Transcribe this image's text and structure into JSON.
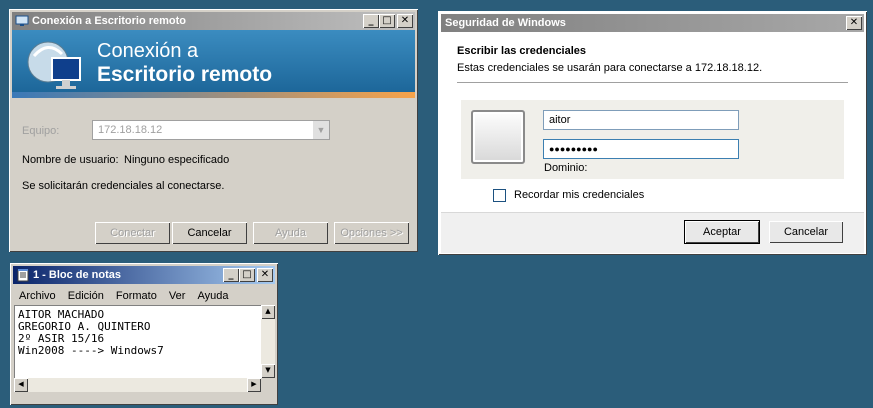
{
  "rdp": {
    "title": "Conexión a Escritorio remoto",
    "banner_line1": "Conexión a",
    "banner_line2": "Escritorio remoto",
    "equipo_label": "Equipo:",
    "equipo_value": "172.18.18.12",
    "usuario_label": "Nombre de usuario:",
    "usuario_value": "Ninguno especificado",
    "info_text": "Se solicitarán credenciales al conectarse.",
    "buttons": {
      "connect": "Conectar",
      "cancel": "Cancelar",
      "help": "Ayuda",
      "options": "Opciones >>"
    }
  },
  "security": {
    "title": "Seguridad de Windows",
    "heading": "Escribir las credenciales",
    "subheading": "Estas credenciales se usarán para conectarse a 172.18.18.12.",
    "username_value": "aitor",
    "password_mask": "●●●●●●●●●",
    "domain_label": "Dominio:",
    "remember_label": "Recordar mis credenciales",
    "accept_label": "Aceptar",
    "cancel_label": "Cancelar"
  },
  "notepad": {
    "title": "1 - Bloc de notas",
    "menu": [
      "Archivo",
      "Edición",
      "Formato",
      "Ver",
      "Ayuda"
    ],
    "lines": [
      "AITOR MACHADO",
      "GREGORIO A. QUINTERO",
      "2º ASIR 15/16",
      "Win2008 ----> Windows7"
    ]
  },
  "colors": {
    "desktop": "#2b5d7a",
    "active_title": "#0a246a",
    "inactive_title": "#808080",
    "banner": "#1f6f9e"
  }
}
